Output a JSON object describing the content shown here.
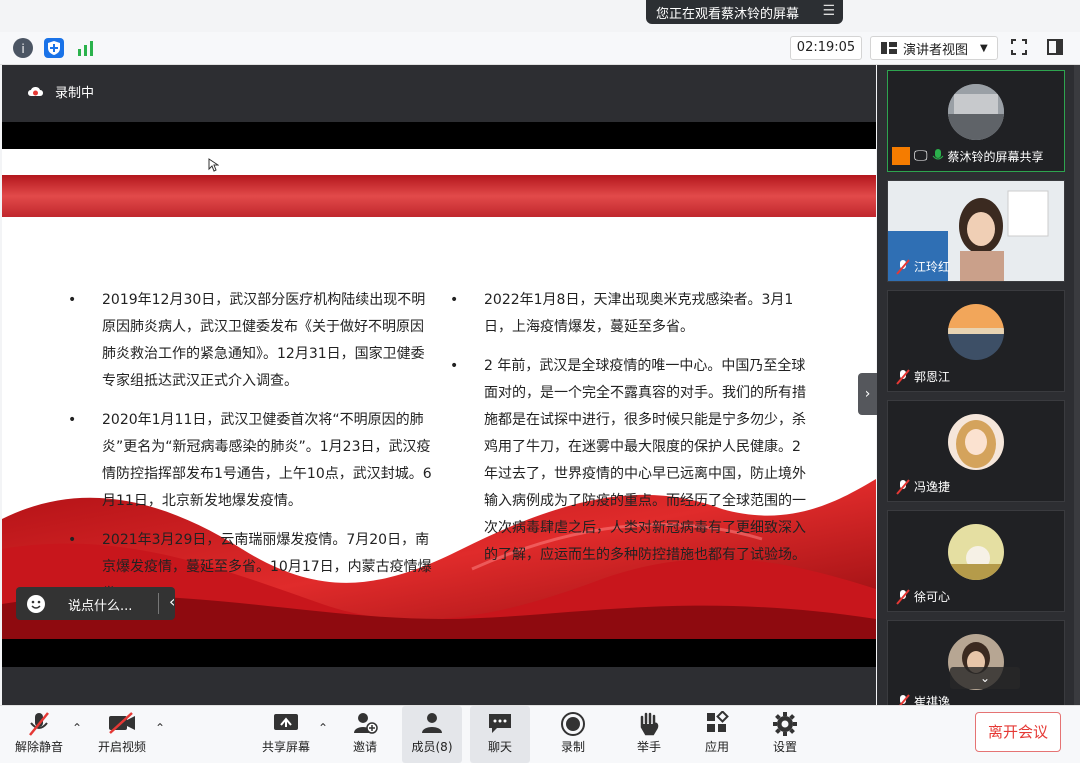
{
  "banner": {
    "viewing_text": "您正在观看蔡沐铃的屏幕"
  },
  "toolbar": {
    "timer": "02:19:05",
    "view_mode": "演讲者视图"
  },
  "recording": {
    "label": "录制中"
  },
  "slide": {
    "left_items": [
      "2019年12月30日，武汉部分医疗机构陆续出现不明原因肺炎病人，武汉卫健委发布《关于做好不明原因肺炎救治工作的紧急通知》。12月31日，国家卫健委专家组抵达武汉正式介入调查。",
      "2020年1月11日，武汉卫健委首次将“不明原因的肺炎”更名为“新冠病毒感染的肺炎”。1月23日，武汉疫情防控指挥部发布1号通告，上午10点，武汉封城。6月11日，北京新发地爆发疫情。",
      "2021年3月29日，云南瑞丽爆发疫情。7月20日，南京爆发疫情，蔓延至多省。10月17日，内蒙古疫情爆发。"
    ],
    "right_items": [
      "2022年1月8日，天津出现奥米克戎感染者。3月1日，上海疫情爆发，蔓延至多省。",
      "2 年前，武汉是全球疫情的唯一中心。中国乃至全球面对的，是一个完全不露真容的对手。我们的所有措施都是在试探中进行，很多时候只能是宁多勿少，杀鸡用了牛刀，在迷雾中最大限度的保护人民健康。2 年过去了，世界疫情的中心早已远离中国，防止境外输入病例成为了防疫的重点。而经历了全球范围的一次次病毒肆虐之后，人类对新冠病毒有了更细致深入的了解，应运而生的多种防控措施也都有了试验场。"
    ]
  },
  "chat": {
    "placeholder": "说点什么..."
  },
  "participants": [
    {
      "name": "蔡沐铃的屏幕共享"
    },
    {
      "name": "江玲红"
    },
    {
      "name": "郭恩江"
    },
    {
      "name": "冯逸捷"
    },
    {
      "name": "徐可心"
    },
    {
      "name": "崔祺逸"
    }
  ],
  "bottom": {
    "unmute": "解除静音",
    "start_video": "开启视频",
    "share_screen": "共享屏幕",
    "invite": "邀请",
    "members": "成员(8)",
    "chat": "聊天",
    "record": "录制",
    "raise_hand": "举手",
    "apps": "应用",
    "settings": "设置",
    "leave": "离开会议"
  }
}
